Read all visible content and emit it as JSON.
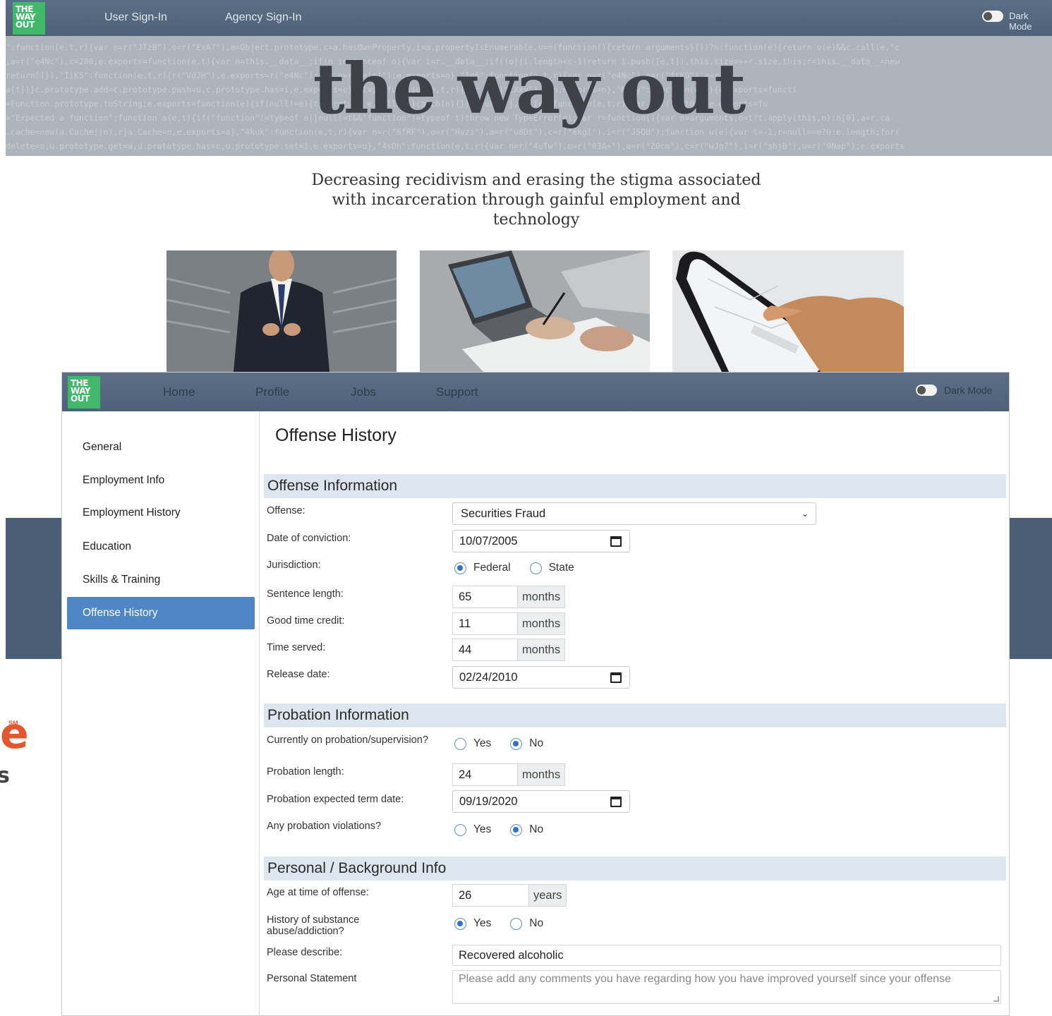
{
  "background": {
    "nav": {
      "user_signin": "User Sign-In",
      "agency_signin": "Agency Sign-In",
      "dark_mode": "Dark Mode"
    },
    "logo": [
      "THE",
      "WAY",
      "OUT"
    ],
    "hero_code": [
      "\":function(e,t,r){var n=r(\"JTzB\"),o=r(\"ExA7\"),a=Object.prototype,c=a.hasOwnProperty,i=a.propertyIsEnumerable,u=n(function(){return arguments}())?n:function(e){return o(e)&&c.call(e,\"c",
      ",a=r(\"e4Nc\"),c=200;e.exports=function(e,t){var n=this.__data__;if(n instanceof o){var i=r.__data__;if(!o||i.length<c-1)return i.push([e,t]),this.size=++r.size,this;r=this.__data__=new",
      "return[]}),\"IiK5\":function(e,t,r){r(\"VdJH\"),e.exports=r(\"e4Nc\");var n=r(\"e[e]\");e.exports=n},\"Ig6\":function(e,t,r){var n=r(\"e4Nc\"),o=r(\"ftKO\"),a=r",
      "a[t])}c.prototype.add=c.prototype.push=u,c.prototype.has=i,e.exports=c},\"Ixy\":function(e,t,r){var n=r(\"LXxy\"),a=n.exports=n},\"NA0y\":function(e,t){e.exports=functi",
      "=Function.prototype.toString;e.exports=function(e){if(null!=e){try{return e.call(e)}catch(n){}}return\"\"},\"KlIc\":function(e,t,r){var n=r(\"ZWtO\");e.exports=fu",
      "=\"Expected a function\";function a(e,t){if(\"function\"!=typeof e||null!=t&&\"function\"!=typeof t)throw new TypeError(o);var r=function(){var n=arguments,o=t?t.apply(this,n):n[0],a=r.ca",
      ".cache=new(a.Cache||n),r}a.Cache=n,e.exports=a},\"4kuk\":function(e,t,r){var n=r(\"SfRF\"),o=r(\"Hvzi\"),a=r(\"u8Dt\"),c=r(\"ekgI\"),i=r(\"JSQU\");function u(e){var t=-1,r=null==e?0:e.length;for(",
      "delete=o,u.prototype.get=a,u.prototype.has=c,u.prototype.set=i,e.exports=u},\"4sDh\":function(e,t,r){var n=r(\"4uTw\"),o=r(\"03A+\"),a=r(\"Z0cm\"),c=r(\"wJg7\"),i=r(\"shjB\"),u=r(\"9Nap\");e.exports"
    ],
    "hero_title": "the way out",
    "tagline": "Decreasing recidivism and erasing the stigma associated with incarceration through gainful employment and technology",
    "side_mark": "e",
    "side_sm": "SM",
    "side_s": "s"
  },
  "app": {
    "logo": [
      "THE",
      "WAY",
      "OUT"
    ],
    "nav": {
      "home": "Home",
      "profile": "Profile",
      "jobs": "Jobs",
      "support": "Support",
      "dark_mode": "Dark Mode"
    },
    "sidebar": [
      {
        "label": "General"
      },
      {
        "label": "Employment Info"
      },
      {
        "label": "Employment History"
      },
      {
        "label": "Education"
      },
      {
        "label": "Skills & Training"
      },
      {
        "label": "Offense History"
      }
    ],
    "page_title": "Offense History",
    "offense": {
      "heading": "Offense Information",
      "offense_label": "Offense:",
      "offense_value": "Securities Fraud",
      "conviction_label": "Date of conviction:",
      "conviction_value": "10/07/2005",
      "jurisdiction_label": "Jurisdiction:",
      "jurisdiction_options": [
        "Federal",
        "State"
      ],
      "jurisdiction_selected": "Federal",
      "sentence_label": "Sentence length:",
      "sentence_value": "65",
      "good_time_label": "Good time credit:",
      "good_time_value": "11",
      "served_label": "Time served:",
      "served_value": "44",
      "release_label": "Release date:",
      "release_value": "02/24/2010",
      "unit_months": "months"
    },
    "probation": {
      "heading": "Probation Information",
      "current_label": "Currently on probation/supervision?",
      "current_options": [
        "Yes",
        "No"
      ],
      "current_selected": "No",
      "length_label": "Probation length:",
      "length_value": "24",
      "term_label": "Probation expected term date:",
      "term_value": "09/19/2020",
      "violations_label": "Any probation violations?",
      "violations_options": [
        "Yes",
        "No"
      ],
      "violations_selected": "No",
      "unit_months": "months"
    },
    "personal": {
      "heading": "Personal / Background Info",
      "age_label": "Age at time of offense:",
      "age_value": "26",
      "unit_years": "years",
      "substance_label": "History of substance abuse/addiction?",
      "substance_options": [
        "Yes",
        "No"
      ],
      "substance_selected": "Yes",
      "describe_label": "Please describe:",
      "describe_value": "Recovered alcoholic",
      "statement_label": "Personal Statement",
      "statement_placeholder": "Please add any comments you have regarding how you have improved yourself since your offense"
    }
  }
}
